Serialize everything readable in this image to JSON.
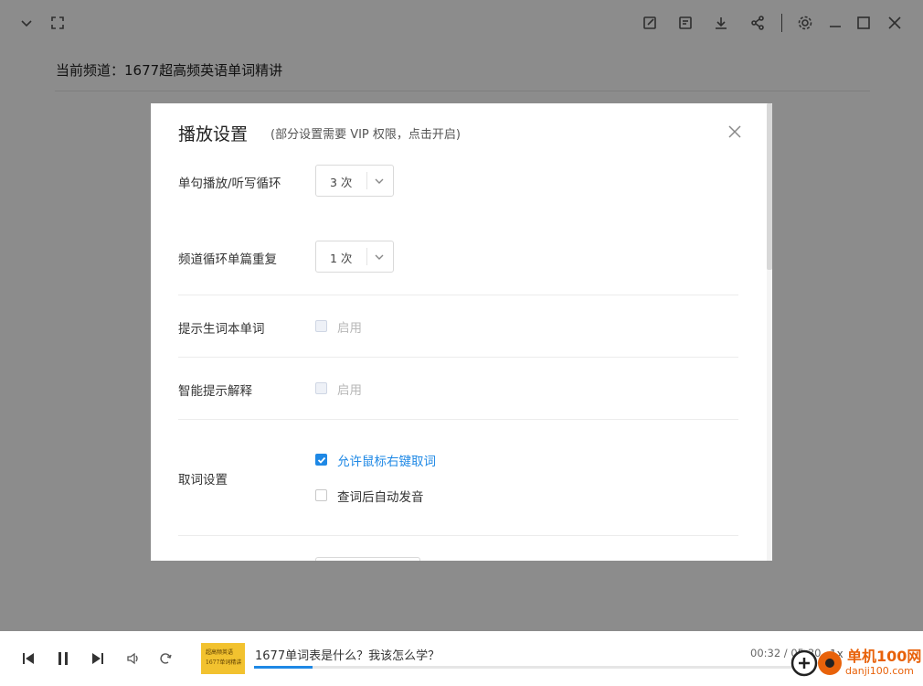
{
  "app": {
    "channel_label": "当前频道：1677超高频英语单词精讲",
    "topbar_icons": [
      "chevron-down-icon",
      "fullscreen-icon",
      "edit-icon",
      "note-icon",
      "download-icon",
      "share-icon",
      "gear-icon",
      "minimize-icon",
      "maximize-icon",
      "close-icon"
    ]
  },
  "modal": {
    "title": "播放设置",
    "subtitle": "(部分设置需要 VIP 权限，点击开启)",
    "rows": [
      {
        "label": "单句播放/听写循环",
        "select_value": "3 次"
      },
      {
        "label": "频道循环单篇重复",
        "select_value": "1 次"
      },
      {
        "label": "提示生词本单词",
        "checkbox_label": "启用",
        "checked": false,
        "disabled": true
      },
      {
        "label": "智能提示解释",
        "checkbox_label": "启用",
        "checked": false,
        "disabled": true
      },
      {
        "label": "取词设置",
        "options": [
          {
            "label": "允许鼠标右键取词",
            "checked": true
          },
          {
            "label": "查词后自动发音",
            "checked": false
          }
        ]
      }
    ]
  },
  "player": {
    "track_title": "1677单词表是什么？我该怎么学？",
    "cover_line1": "超高频英语",
    "cover_line2": "1677单词精讲",
    "time": "00:32 / 05:30",
    "progress": 0.105,
    "speed": "1x",
    "watermark_name": "单机100网",
    "watermark_url": "danji100.com",
    "accent": "#1e88e5"
  }
}
